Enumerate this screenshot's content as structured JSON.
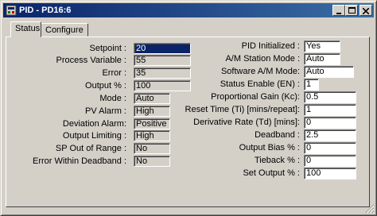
{
  "window": {
    "title": "PID - PD16:6",
    "minimize_icon": "minimize-icon",
    "maximize_icon": "maximize-icon",
    "close_icon": "close-icon"
  },
  "tabs": [
    {
      "label": "Status",
      "active": true
    },
    {
      "label": "Configure",
      "active": false
    }
  ],
  "left": [
    {
      "label": "Setpoint :",
      "value": "20"
    },
    {
      "label": "Process Variable :",
      "value": "55"
    },
    {
      "label": "Error :",
      "value": "35"
    },
    {
      "label": "Output % :",
      "value": "100"
    },
    {
      "label": "Mode :",
      "value": "Auto"
    },
    {
      "label": "PV Alarm :",
      "value": "High"
    },
    {
      "label": "Deviation Alarm:",
      "value": "Positive"
    },
    {
      "label": "Output Limiting :",
      "value": "High"
    },
    {
      "label": "SP Out of Range :",
      "value": "No"
    },
    {
      "label": "Error Within Deadband :",
      "value": "No"
    }
  ],
  "right": [
    {
      "label": "PID Initialized :",
      "value": "Yes"
    },
    {
      "label": "A/M Station Mode :",
      "value": "Auto"
    },
    {
      "label": "Software A/M Mode:",
      "value": "Auto"
    },
    {
      "label": "Status Enable (EN) :",
      "value": "1"
    },
    {
      "label": "Proportional Gain (Kc):",
      "value": "0.5"
    },
    {
      "label": "Reset Time (Ti) [mins/repeat]:",
      "value": "1"
    },
    {
      "label": "Derivative Rate (Td) [mins]:",
      "value": "0"
    },
    {
      "label": "Deadband :",
      "value": "2.5"
    },
    {
      "label": "Output Bias % :",
      "value": "0"
    },
    {
      "label": "Tieback % :",
      "value": "0"
    },
    {
      "label": "Set Output % :",
      "value": "100"
    }
  ]
}
